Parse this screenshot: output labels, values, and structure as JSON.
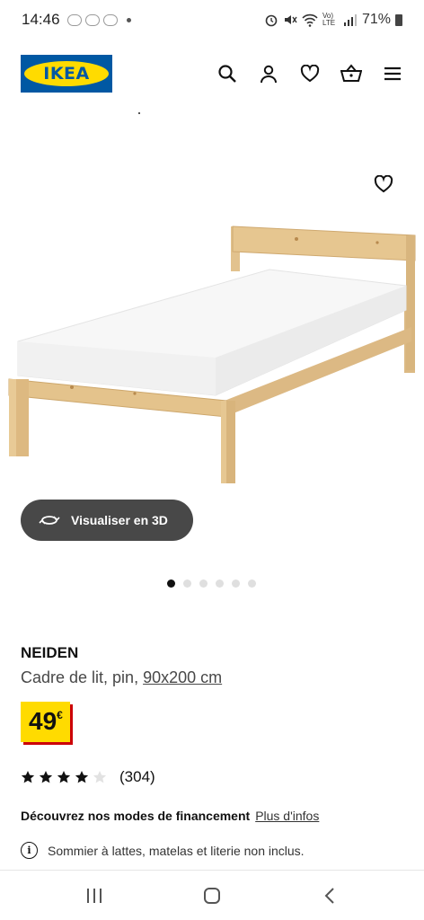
{
  "status_bar": {
    "time": "14:46",
    "network_label": "Vo) LTE",
    "battery": "71%"
  },
  "header": {
    "logo_text": "IKEA",
    "icons": [
      "search-icon",
      "user-icon",
      "heart-icon",
      "basket-icon",
      "menu-icon"
    ]
  },
  "product": {
    "name": "NEIDEN",
    "description": "Cadre de lit, pin, ",
    "size": "90x200 cm",
    "price": "49",
    "currency": "€",
    "rating_stars": 4,
    "rating_max": 5,
    "rating_count": "(304)"
  },
  "visualize_button": {
    "label": "Visualiser en 3D"
  },
  "gallery": {
    "image_count": 6,
    "active_index": 0
  },
  "financing": {
    "label": "Découvrez nos modes de financement",
    "link": "Plus d'infos"
  },
  "notice": {
    "text": "Sommier à lattes, matelas et literie non inclus."
  },
  "colors": {
    "ikea_blue": "#0058a3",
    "ikea_yellow": "#ffdb00",
    "price_shadow": "#cc0008",
    "button_dark": "#484848"
  }
}
